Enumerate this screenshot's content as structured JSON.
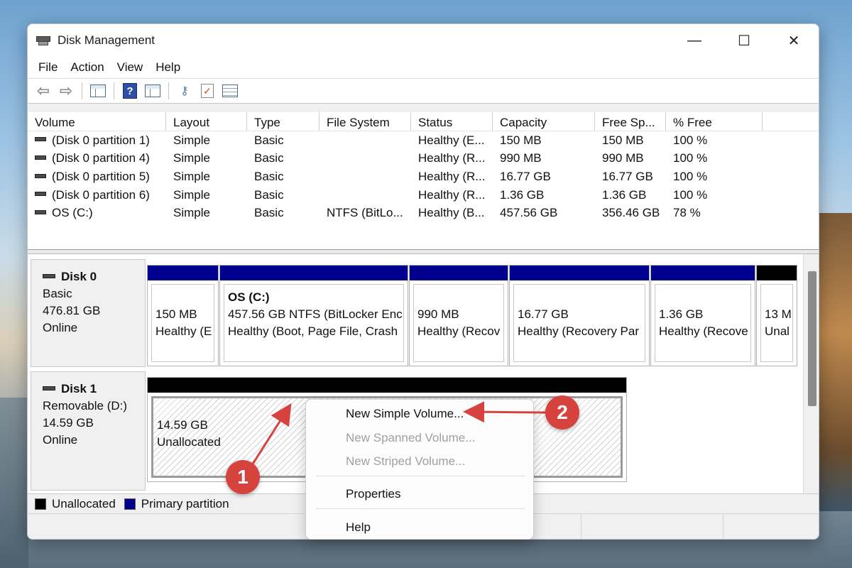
{
  "window": {
    "title": "Disk Management"
  },
  "window_controls": {
    "minimize": "—",
    "maximize": "☐",
    "close": "✕"
  },
  "menu": [
    "File",
    "Action",
    "View",
    "Help"
  ],
  "toolbar": {
    "icons": [
      "back-arrow-icon",
      "forward-arrow-icon",
      "show-hide-console-tree-icon",
      "help-icon",
      "properties-pane-icon",
      "connect-icon",
      "check-icon",
      "list-view-icon"
    ]
  },
  "volume_table": {
    "columns": [
      "Volume",
      "Layout",
      "Type",
      "File System",
      "Status",
      "Capacity",
      "Free Sp...",
      "% Free"
    ],
    "rows": [
      [
        "(Disk 0 partition 1)",
        "Simple",
        "Basic",
        "",
        "Healthy (E...",
        "150 MB",
        "150 MB",
        "100 %"
      ],
      [
        "(Disk 0 partition 4)",
        "Simple",
        "Basic",
        "",
        "Healthy (R...",
        "990 MB",
        "990 MB",
        "100 %"
      ],
      [
        "(Disk 0 partition 5)",
        "Simple",
        "Basic",
        "",
        "Healthy (R...",
        "16.77 GB",
        "16.77 GB",
        "100 %"
      ],
      [
        "(Disk 0 partition 6)",
        "Simple",
        "Basic",
        "",
        "Healthy (R...",
        "1.36 GB",
        "1.36 GB",
        "100 %"
      ],
      [
        "OS (C:)",
        "Simple",
        "Basic",
        "NTFS (BitLo...",
        "Healthy (B...",
        "457.56 GB",
        "356.46 GB",
        "78 %"
      ]
    ]
  },
  "disks": [
    {
      "name": "Disk 0",
      "type": "Basic",
      "size": "476.81 GB",
      "status": "Online",
      "partitions": [
        {
          "title": "",
          "line1": "150 MB",
          "line2": "Healthy (E"
        },
        {
          "title": "OS  (C:)",
          "line1": "457.56 GB NTFS (BitLocker Enc",
          "line2": "Healthy (Boot, Page File, Crash"
        },
        {
          "title": "",
          "line1": "990 MB",
          "line2": "Healthy (Recov"
        },
        {
          "title": "",
          "line1": "16.77 GB",
          "line2": "Healthy (Recovery Par"
        },
        {
          "title": "",
          "line1": "1.36 GB",
          "line2": "Healthy (Recove"
        },
        {
          "title": "",
          "line1": "13 M",
          "line2": "Unal"
        }
      ]
    },
    {
      "name": "Disk 1",
      "type": "Removable (D:)",
      "size": "14.59 GB",
      "status": "Online",
      "partitions": [
        {
          "title": "",
          "line1": "14.59 GB",
          "line2": "Unallocated"
        }
      ]
    }
  ],
  "legend": {
    "unallocated": "Unallocated",
    "primary": "Primary partition"
  },
  "context_menu": {
    "items": [
      "New Simple Volume...",
      "New Spanned Volume...",
      "New Striped Volume...",
      "Properties",
      "Help"
    ]
  },
  "callouts": [
    "1",
    "2"
  ],
  "colors": {
    "primary_partition": "#00008c",
    "unallocated": "#000000",
    "callout": "#d6433f"
  }
}
